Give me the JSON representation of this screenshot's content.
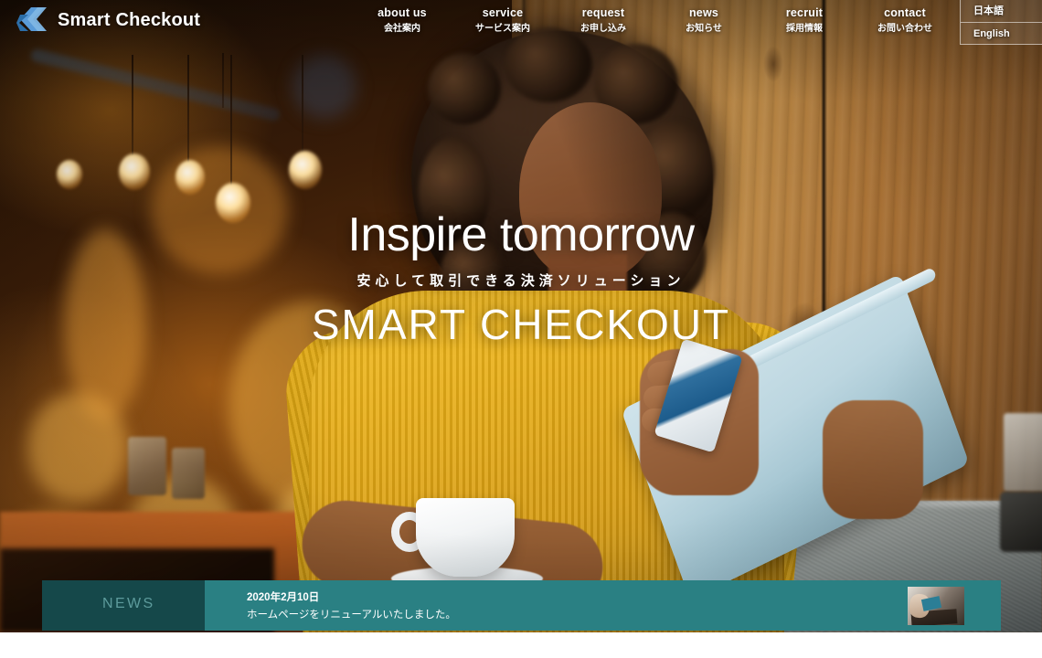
{
  "header": {
    "logo_text": "Smart Checkout",
    "logo_icon": "chevron-logo-icon",
    "nav": [
      {
        "en": "about us",
        "ja": "会社案内"
      },
      {
        "en": "service",
        "ja": "サービス案内"
      },
      {
        "en": "request",
        "ja": "お申し込み"
      },
      {
        "en": "news",
        "ja": "お知らせ"
      },
      {
        "en": "recruit",
        "ja": "採用情報"
      },
      {
        "en": "contact",
        "ja": "お問い合わせ"
      }
    ],
    "languages": [
      {
        "label": "日本語"
      },
      {
        "label": "English"
      }
    ]
  },
  "hero": {
    "title": "Inspire tomorrow",
    "subtitle": "安心して取引できる決済ソリューション",
    "brand": "SMART CHECKOUT"
  },
  "news": {
    "label": "NEWS",
    "items": [
      {
        "date": "2020年2月10日",
        "text": "ホームページをリニューアルいたしました。",
        "thumbnail": "news-thumbnail-image"
      }
    ]
  },
  "colors": {
    "news_label_bg": "#15484a",
    "news_body_bg": "#2a8083",
    "news_label_text": "#5d9b9c",
    "logo_blue": "#4a8fd4",
    "text_white": "#ffffff"
  }
}
